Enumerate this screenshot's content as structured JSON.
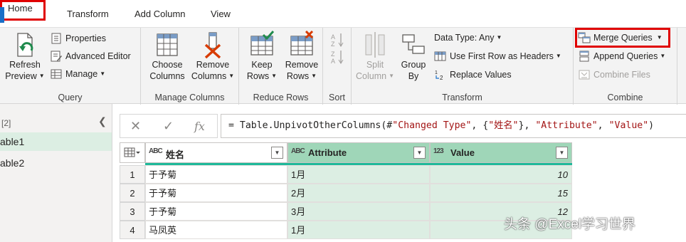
{
  "tabs": [
    "Home",
    "Transform",
    "Add Column",
    "View"
  ],
  "ribbon": {
    "query": {
      "label": "Query",
      "refresh_line1": "Refresh",
      "refresh_line2": "Preview",
      "properties": "Properties",
      "advanced_editor": "Advanced Editor",
      "manage": "Manage"
    },
    "manage_columns": {
      "label": "Manage Columns",
      "choose_line1": "Choose",
      "choose_line2": "Columns",
      "remove_line1": "Remove",
      "remove_line2": "Columns"
    },
    "reduce_rows": {
      "label": "Reduce Rows",
      "keep_line1": "Keep",
      "keep_line2": "Rows",
      "remove_line1": "Remove",
      "remove_line2": "Rows"
    },
    "sort": {
      "label": "Sort"
    },
    "transform": {
      "label": "Transform",
      "split_line1": "Split",
      "split_line2": "Column",
      "group_line1": "Group",
      "group_line2": "By",
      "data_type": "Data Type: Any",
      "first_row": "Use First Row as Headers",
      "replace_values": "Replace Values"
    },
    "combine": {
      "label": "Combine",
      "merge": "Merge Queries",
      "append": "Append Queries",
      "combine_files": "Combine Files"
    }
  },
  "left_pane": {
    "count": "[2]",
    "items": [
      "able1",
      "able2"
    ]
  },
  "formula": {
    "prefix": "= Table.UnpivotOtherColumns(#",
    "s1": "\"Changed Type\"",
    "mid1": ", {",
    "s2": "\"姓名\"",
    "mid2": "}, ",
    "s3": "\"Attribute\"",
    "mid3": ", ",
    "s4": "\"Value\"",
    "suffix": ")"
  },
  "grid": {
    "columns": [
      {
        "type": "ABC",
        "name": "姓名"
      },
      {
        "type": "ABC",
        "name": "Attribute"
      },
      {
        "type": "123",
        "name": "Value"
      }
    ],
    "rows": [
      {
        "n": "1",
        "name": "于予菊",
        "attr": "1月",
        "value": "10"
      },
      {
        "n": "2",
        "name": "于予菊",
        "attr": "2月",
        "value": "15"
      },
      {
        "n": "3",
        "name": "于予菊",
        "attr": "3月",
        "value": "12"
      },
      {
        "n": "4",
        "name": "马凤英",
        "attr": "1月",
        "value": ""
      }
    ]
  },
  "watermark": "头条 @Excel学习世界"
}
